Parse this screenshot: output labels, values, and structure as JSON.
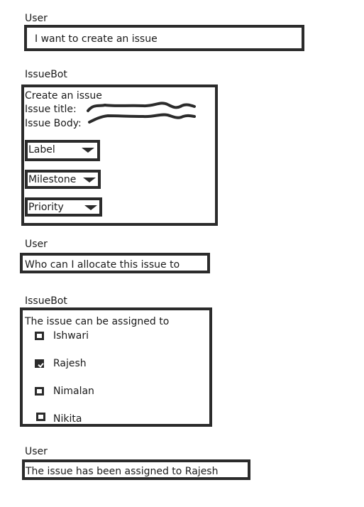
{
  "conversation": {
    "msg1": {
      "speaker": "User",
      "text": "I want to create an issue"
    },
    "bot1": {
      "speaker": "IssueBot",
      "heading": "Create an issue",
      "title_label": "Issue title:",
      "body_label": "Issue Body:",
      "dropdowns": {
        "label": "Label",
        "milestone": "Milestone",
        "priority": "Priority"
      }
    },
    "msg2": {
      "speaker": "User",
      "text": "Who can I allocate this issue to"
    },
    "bot2": {
      "speaker": "IssueBot",
      "heading": "The issue can be assigned to",
      "assignees": [
        {
          "name": "Ishwari",
          "checked": false
        },
        {
          "name": "Rajesh",
          "checked": true
        },
        {
          "name": "Nimalan",
          "checked": false
        },
        {
          "name": "Nikita",
          "checked": false
        }
      ]
    },
    "msg3": {
      "speaker": "User",
      "text": "The issue has been assigned to Rajesh"
    }
  }
}
